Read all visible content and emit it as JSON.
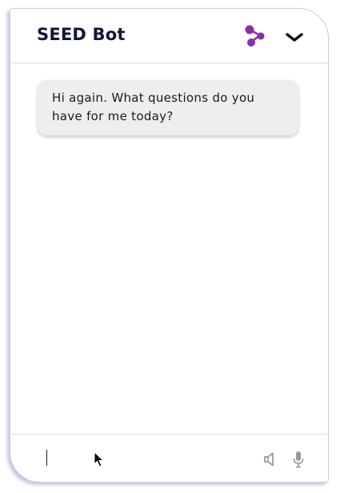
{
  "header": {
    "title": "SEED Bot",
    "share_icon": "share-nodes-icon",
    "collapse_icon": "chevron-down-icon",
    "accent_color": "#8b2fa8"
  },
  "messages": [
    {
      "sender": "bot",
      "text": "Hi again. What questions do you have for me today?"
    }
  ],
  "composer": {
    "value": "",
    "placeholder": "",
    "speaker_icon": "speaker-icon",
    "mic_icon": "microphone-icon"
  }
}
